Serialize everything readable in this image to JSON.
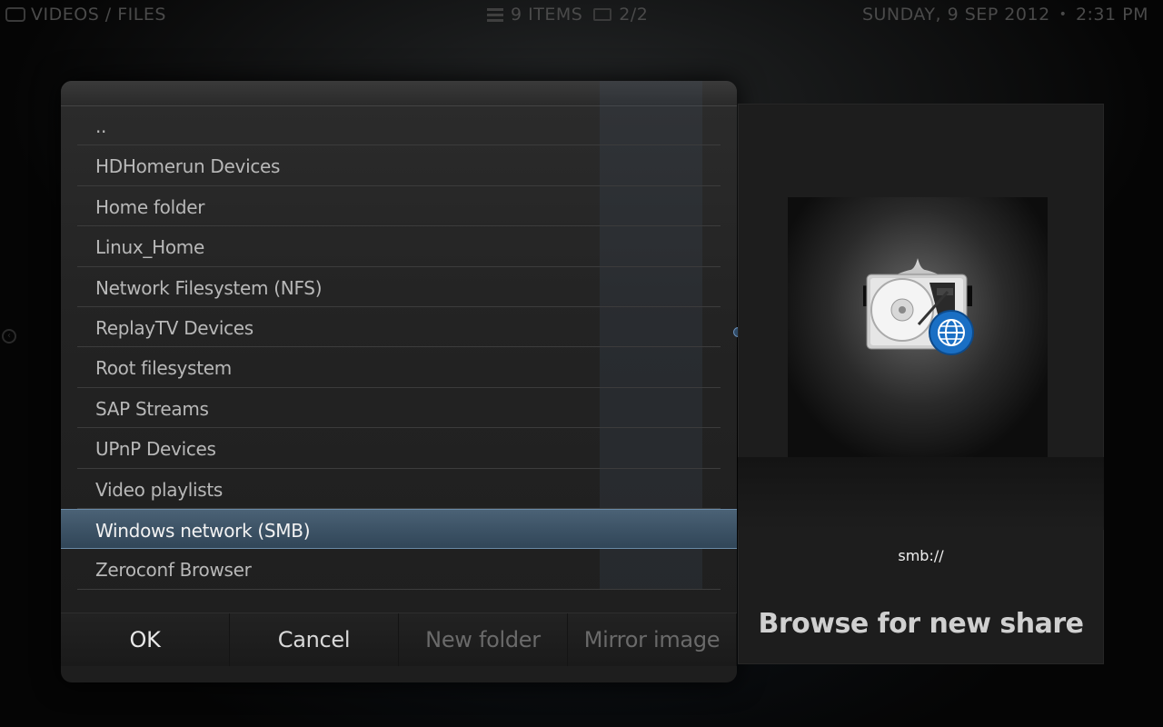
{
  "topbar": {
    "section": "VIDEOS / FILES",
    "items_count": "9 ITEMS",
    "page": "2/2",
    "date": "SUNDAY, 9 SEP 2012",
    "time": "2:31 PM"
  },
  "dialog": {
    "items": [
      {
        "label": ".."
      },
      {
        "label": "HDHomerun Devices"
      },
      {
        "label": "Home folder"
      },
      {
        "label": "Linux_Home"
      },
      {
        "label": "Network Filesystem (NFS)"
      },
      {
        "label": "ReplayTV Devices"
      },
      {
        "label": "Root filesystem"
      },
      {
        "label": "SAP Streams"
      },
      {
        "label": "UPnP Devices"
      },
      {
        "label": "Video playlists"
      },
      {
        "label": "Windows network (SMB)"
      },
      {
        "label": "Zeroconf Browser"
      }
    ],
    "selected_index": 10,
    "buttons": {
      "ok": "OK",
      "cancel": "Cancel",
      "new_folder": "New folder",
      "mirror_image": "Mirror image"
    }
  },
  "info": {
    "url": "smb://",
    "title": "Browse for new share"
  },
  "icons": {
    "thumbnail": "network-hard-drive-icon",
    "globe": "globe-icon"
  },
  "colors": {
    "selection": "#3d5366",
    "accent": "#6a8aa6"
  }
}
